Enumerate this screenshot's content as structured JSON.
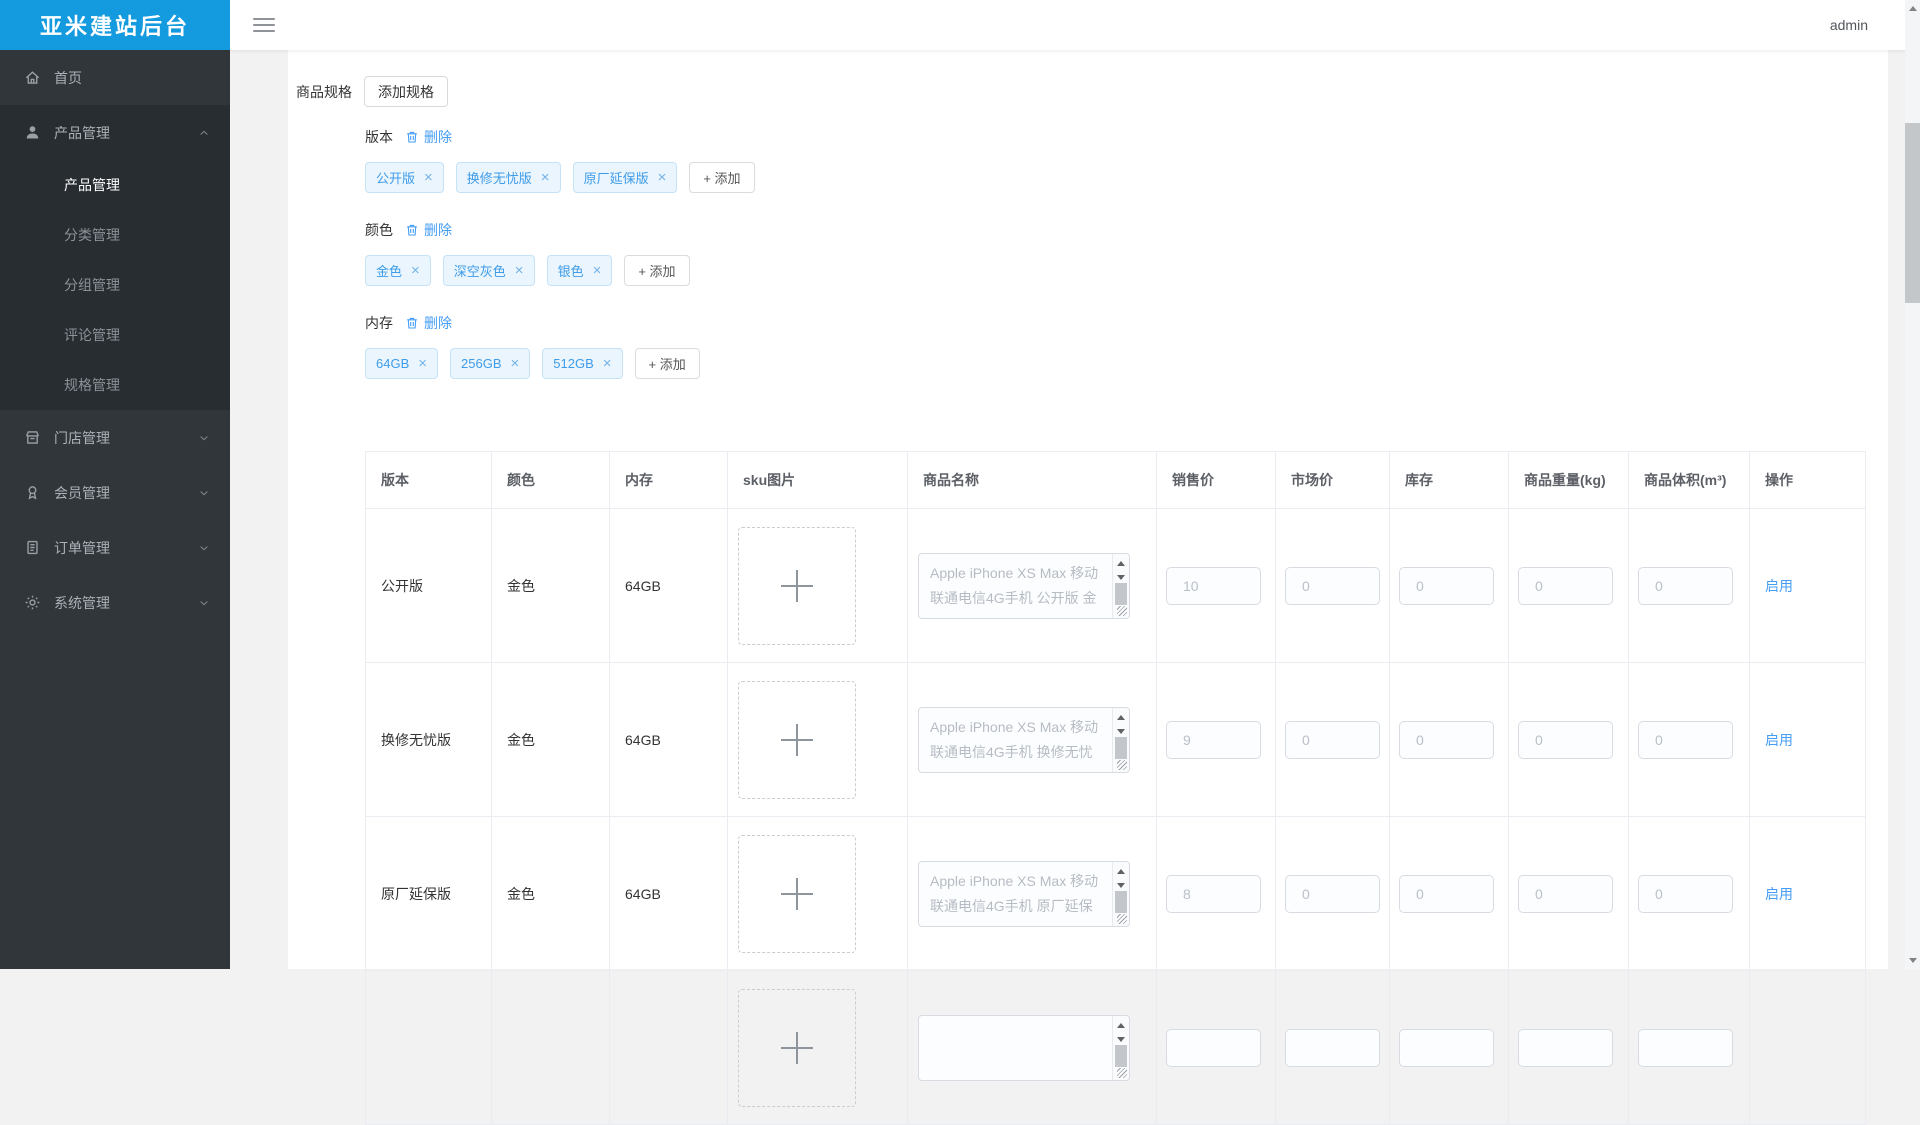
{
  "app": {
    "title": "亚米建站后台",
    "user": "admin"
  },
  "sidebar": {
    "items": [
      {
        "label": "首页",
        "icon": "home-icon"
      },
      {
        "label": "产品管理",
        "icon": "user-icon",
        "expanded": true,
        "children": [
          {
            "label": "产品管理",
            "active": true
          },
          {
            "label": "分类管理",
            "active": false
          },
          {
            "label": "分组管理",
            "active": false
          },
          {
            "label": "评论管理",
            "active": false
          },
          {
            "label": "规格管理",
            "active": false
          }
        ]
      },
      {
        "label": "门店管理",
        "icon": "store-icon"
      },
      {
        "label": "会员管理",
        "icon": "member-icon"
      },
      {
        "label": "订单管理",
        "icon": "order-icon"
      },
      {
        "label": "系统管理",
        "icon": "gear-icon"
      }
    ]
  },
  "content": {
    "section_label": "商品规格",
    "add_spec_button": "添加规格",
    "delete_label": "删除",
    "add_tag_label": "+ 添加",
    "close_char": "×",
    "spec_groups": [
      {
        "name": "版本",
        "tags": [
          "公开版",
          "换修无忧版",
          "原厂延保版"
        ]
      },
      {
        "name": "颜色",
        "tags": [
          "金色",
          "深空灰色",
          "银色"
        ]
      },
      {
        "name": "内存",
        "tags": [
          "64GB",
          "256GB",
          "512GB"
        ]
      }
    ],
    "table": {
      "columns": [
        "版本",
        "颜色",
        "内存",
        "sku图片",
        "商品名称",
        "销售价",
        "市场价",
        "库存",
        "商品重量(kg)",
        "商品体积(m³)",
        "操作"
      ],
      "rows": [
        {
          "version": "公开版",
          "color": "金色",
          "memory": "64GB",
          "name": "Apple iPhone XS Max 移动联通电信4G手机 公开版 金",
          "sale_price": "10",
          "market_price": "0",
          "stock": "0",
          "weight": "0",
          "volume": "0",
          "action": "启用"
        },
        {
          "version": "换修无忧版",
          "color": "金色",
          "memory": "64GB",
          "name": "Apple iPhone XS Max 移动联通电信4G手机 换修无忧",
          "sale_price": "9",
          "market_price": "0",
          "stock": "0",
          "weight": "0",
          "volume": "0",
          "action": "启用"
        },
        {
          "version": "原厂延保版",
          "color": "金色",
          "memory": "64GB",
          "name": "Apple iPhone XS Max 移动联通电信4G手机 原厂延保",
          "sale_price": "8",
          "market_price": "0",
          "stock": "0",
          "weight": "0",
          "volume": "0",
          "action": "启用"
        },
        {
          "version": "",
          "color": "",
          "memory": "",
          "name": "",
          "sale_price": "",
          "market_price": "",
          "stock": "",
          "weight": "",
          "volume": "",
          "action": ""
        }
      ]
    }
  },
  "colors": {
    "brand_blue": "#149ade",
    "link_blue": "#459df5",
    "tag_text_blue": "#3f9ce9",
    "tag_bg": "#eaf5fd",
    "tag_border": "#c6e2f7",
    "sidebar_bg": "#31363b",
    "sidebar_submenu_bg": "#282d32"
  }
}
